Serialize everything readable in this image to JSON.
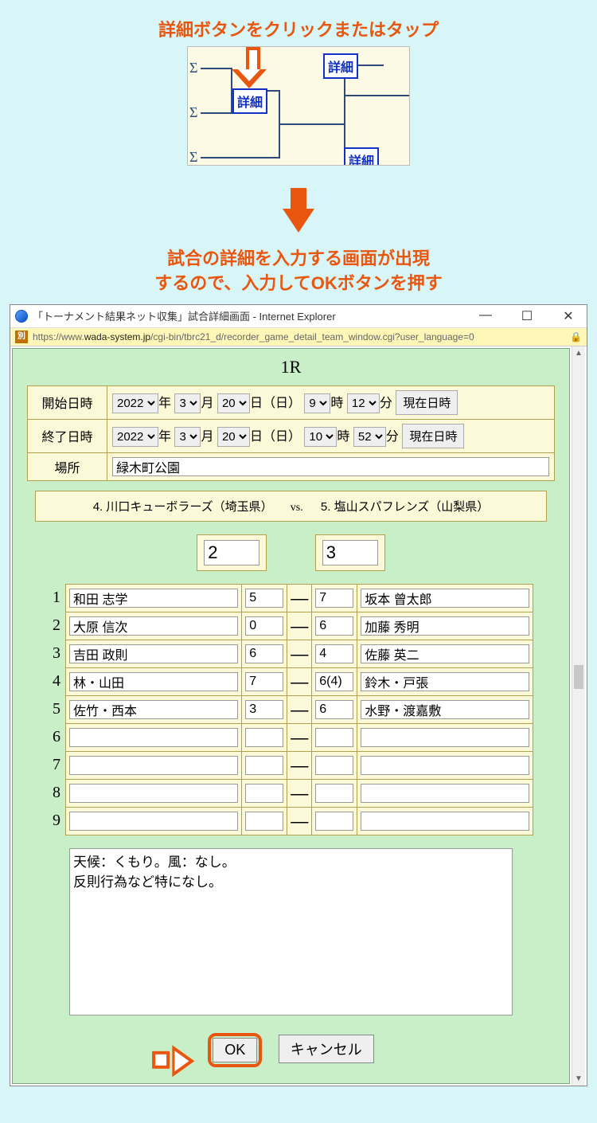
{
  "instructions": {
    "top": "詳細ボタンをクリックまたはタップ",
    "mid_line1": "試合の詳細を入力する画面が出現",
    "mid_line2": "するので、入力してOKボタンを押す"
  },
  "bracket": {
    "button_label": "詳細"
  },
  "ie": {
    "title": "「トーナメント結果ネット収集」試合詳細画面 - Internet Explorer",
    "url_prefix": "https://www.",
    "url_host": "wada-system.jp",
    "url_rest": "/cgi-bin/tbrc21_d/recorder_game_detail_team_window.cgi?user_language=0",
    "url_badge": "別",
    "minimize": "—",
    "maximize": "☐",
    "close": "✕",
    "lock": "🔒"
  },
  "form": {
    "round": "1R",
    "labels": {
      "start": "開始日時",
      "end": "終了日時",
      "location": "場所",
      "year": "年",
      "month": "月",
      "day": "日",
      "dow": "（日）",
      "hour": "時",
      "minute": "分",
      "now": "現在日時",
      "vs": "vs.",
      "dash": "—",
      "ok": "OK",
      "cancel": "キャンセル"
    },
    "start": {
      "year": "2022",
      "month": "3",
      "day": "20",
      "hour": "9",
      "minute": "12"
    },
    "end": {
      "year": "2022",
      "month": "3",
      "day": "20",
      "hour": "10",
      "minute": "52"
    },
    "location": "緑木町公園",
    "team_left": "4.  川口キューボラーズ（埼玉県）",
    "team_right": "5.  塩山スパフレンズ（山梨県）",
    "score_left": "2",
    "score_right": "3",
    "rows": [
      {
        "n": "1",
        "pl": "和田 志学",
        "sl": "5",
        "sr": "7",
        "pr": "坂本 曾太郎"
      },
      {
        "n": "2",
        "pl": "大原 信次",
        "sl": "0",
        "sr": "6",
        "pr": "加藤 秀明"
      },
      {
        "n": "3",
        "pl": "吉田 政則",
        "sl": "6",
        "sr": "4",
        "pr": "佐藤 英二"
      },
      {
        "n": "4",
        "pl": "林・山田",
        "sl": "7",
        "sr": "6(4)",
        "pr": "鈴木・戸張"
      },
      {
        "n": "5",
        "pl": "佐竹・西本",
        "sl": "3",
        "sr": "6",
        "pr": "水野・渡嘉敷"
      },
      {
        "n": "6",
        "pl": "",
        "sl": "",
        "sr": "",
        "pr": ""
      },
      {
        "n": "7",
        "pl": "",
        "sl": "",
        "sr": "",
        "pr": ""
      },
      {
        "n": "8",
        "pl": "",
        "sl": "",
        "sr": "",
        "pr": ""
      },
      {
        "n": "9",
        "pl": "",
        "sl": "",
        "sr": "",
        "pr": ""
      }
    ],
    "notes": "天候：くもり。風：なし。\n反則行為など特になし。"
  }
}
